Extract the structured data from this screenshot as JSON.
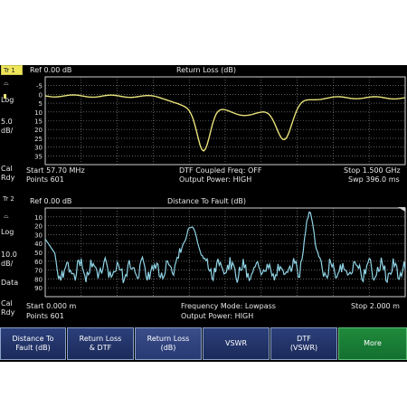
{
  "trace1": {
    "badge": "Tr 1",
    "ref": "Ref 0.00 dB",
    "title": "Return Loss (dB)",
    "side": {
      "format": "Log",
      "scale": "5.0",
      "unit": "dB/",
      "cal": "Cal",
      "rdy": "Rdy"
    },
    "y_ticks": [
      "-5",
      "0",
      "5",
      "10",
      "15",
      "20",
      "25",
      "30",
      "35"
    ],
    "start": "Start 57.70 MHz",
    "points": "Points 601",
    "mid1": "DTF Coupled Freq: OFF",
    "mid2": "Output Power: HIGH",
    "stop": "Stop 1.500 GHz",
    "swp": "Swp 396.0 ms",
    "color": "#e8e27a"
  },
  "trace2": {
    "badge": "Tr 2",
    "ref": "Ref 0.00 dB",
    "title": "Distance To Fault (dB)",
    "side": {
      "format": "Log",
      "scale": "10.0",
      "unit": "dB/",
      "data": "Data",
      "cal": "Cal",
      "rdy": "Rdy"
    },
    "y_ticks": [
      "10",
      "20",
      "30",
      "40",
      "50",
      "60",
      "70",
      "80",
      "90"
    ],
    "start": "Start 0.000 m",
    "points": "Points 601",
    "mid1": "Frequency Mode: Lowpass",
    "mid2": "Output Power: HIGH",
    "stop": "Stop 2.000 m",
    "color": "#8fd4e6"
  },
  "softkeys": [
    {
      "label": "Distance To\nFault (dB)"
    },
    {
      "label": "Return Loss\n& DTF"
    },
    {
      "label": "Return Loss\n(dB)"
    },
    {
      "label": "VSWR"
    },
    {
      "label": "DTF\n(VSWR)"
    },
    {
      "label": "More"
    }
  ]
}
